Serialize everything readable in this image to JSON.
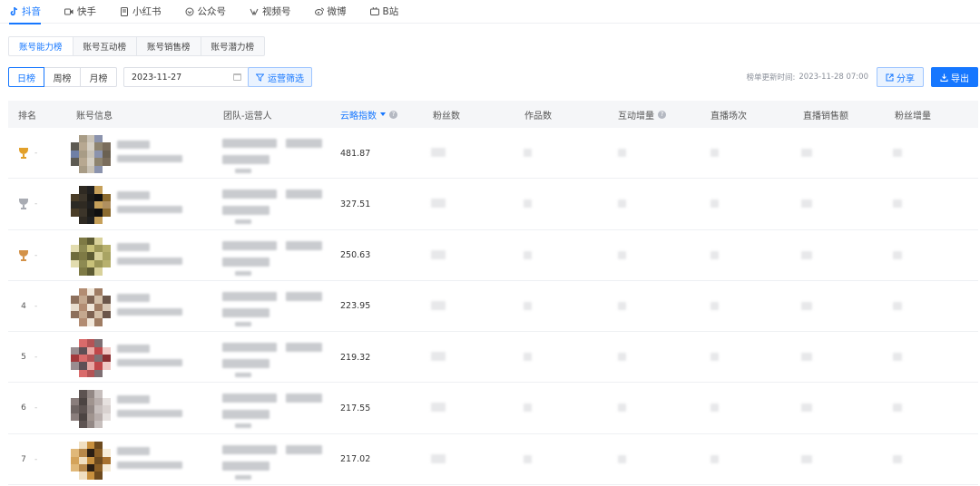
{
  "platform_tabs": [
    {
      "label": "抖音",
      "icon": "douyin-icon",
      "active": true
    },
    {
      "label": "快手",
      "icon": "kuaishou-icon",
      "active": false
    },
    {
      "label": "小红书",
      "icon": "xiaohongshu-icon",
      "active": false
    },
    {
      "label": "公众号",
      "icon": "wechat-official-icon",
      "active": false
    },
    {
      "label": "视频号",
      "icon": "channels-icon",
      "active": false
    },
    {
      "label": "微博",
      "icon": "weibo-icon",
      "active": false
    },
    {
      "label": "B站",
      "icon": "bilibili-icon",
      "active": false
    }
  ],
  "sub_tabs": [
    {
      "label": "账号能力榜",
      "active": true
    },
    {
      "label": "账号互动榜",
      "active": false
    },
    {
      "label": "账号销售榜",
      "active": false
    },
    {
      "label": "账号潜力榜",
      "active": false
    }
  ],
  "toolbar": {
    "period_buttons": [
      "日榜",
      "周榜",
      "月榜"
    ],
    "active_period": "日榜",
    "date_value": "2023-11-27",
    "filter_label": "运营筛选",
    "update_label": "榜单更新时间:",
    "update_time": "2023-11-28 07:00",
    "share_label": "分享",
    "export_label": "导出"
  },
  "table": {
    "columns": [
      "排名",
      "账号信息",
      "团队-运营人",
      "云略指数",
      "粉丝数",
      "作品数",
      "互动增量",
      "直播场次",
      "直播销售额",
      "粉丝增量"
    ],
    "sorted_column": "云略指数",
    "rows": [
      {
        "rank": "1",
        "rank_change": "-",
        "score": "481.87"
      },
      {
        "rank": "2",
        "rank_change": "-",
        "score": "327.51"
      },
      {
        "rank": "3",
        "rank_change": "-",
        "score": "250.63"
      },
      {
        "rank": "4",
        "rank_change": "-",
        "score": "223.95"
      },
      {
        "rank": "5",
        "rank_change": "-",
        "score": "219.32"
      },
      {
        "rank": "6",
        "rank_change": "-",
        "score": "217.55"
      },
      {
        "rank": "7",
        "rank_change": "-",
        "score": "217.02"
      }
    ]
  },
  "colors": {
    "accent": "#1677ff",
    "gold": "#e2a02a",
    "silver": "#a9acb3",
    "bronze": "#d39249"
  }
}
